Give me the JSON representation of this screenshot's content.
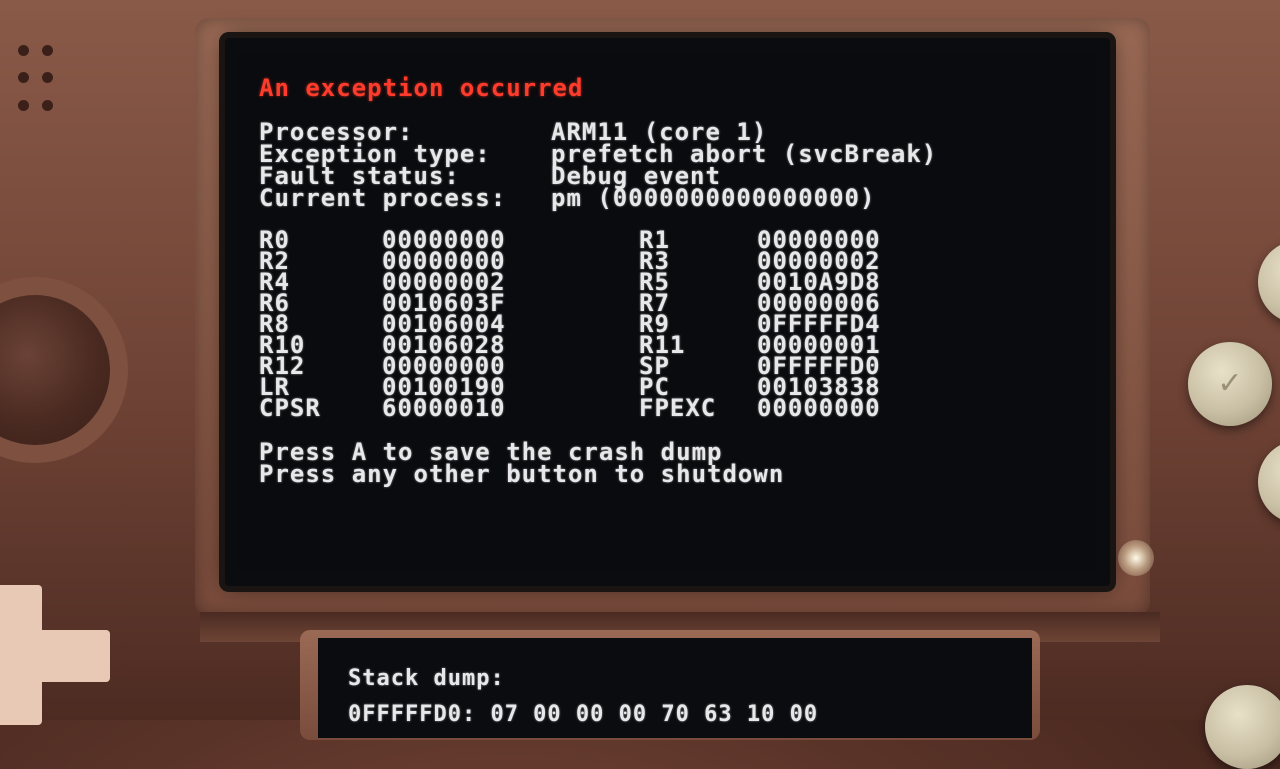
{
  "screen": {
    "title": "An exception occurred",
    "info": [
      {
        "label": "Processor:",
        "value": "ARM11 (core 1)"
      },
      {
        "label": "Exception type:",
        "value": "prefetch abort (svcBreak)"
      },
      {
        "label": "Fault status:",
        "value": "Debug event"
      },
      {
        "label": "Current process:",
        "value": "pm (0000000000000000)"
      }
    ],
    "registers_left": [
      {
        "name": "R0",
        "value": "00000000"
      },
      {
        "name": "R2",
        "value": "00000000"
      },
      {
        "name": "R4",
        "value": "00000002"
      },
      {
        "name": "R6",
        "value": "0010603F"
      },
      {
        "name": "R8",
        "value": "00106004"
      },
      {
        "name": "R10",
        "value": "00106028"
      },
      {
        "name": "R12",
        "value": "00000000"
      },
      {
        "name": "LR",
        "value": "00100190"
      },
      {
        "name": "CPSR",
        "value": "60000010"
      }
    ],
    "registers_right": [
      {
        "name": "R1",
        "value": "00000000"
      },
      {
        "name": "R3",
        "value": "00000002"
      },
      {
        "name": "R5",
        "value": "0010A9D8"
      },
      {
        "name": "R7",
        "value": "00000006"
      },
      {
        "name": "R9",
        "value": "0FFFFFD4"
      },
      {
        "name": "R11",
        "value": "00000001"
      },
      {
        "name": "SP",
        "value": "0FFFFFD0"
      },
      {
        "name": "PC",
        "value": "00103838"
      },
      {
        "name": "FPEXC",
        "value": "00000000"
      }
    ],
    "prompt_save": "Press A to save the crash dump",
    "prompt_shutdown": "Press any other button to shutdown"
  },
  "bottom_screen": {
    "stack_title": "Stack dump:",
    "stack_line": "0FFFFFD0: 07 00 00 00 70 63 10 00"
  },
  "colors": {
    "title_red": "#ff3b2c",
    "text": "#e8e8ea",
    "screen_bg": "#0a0b0e"
  },
  "icons": [
    "speaker-grille-icon",
    "circle-pad-icon",
    "dpad-icon",
    "a-button-icon"
  ]
}
